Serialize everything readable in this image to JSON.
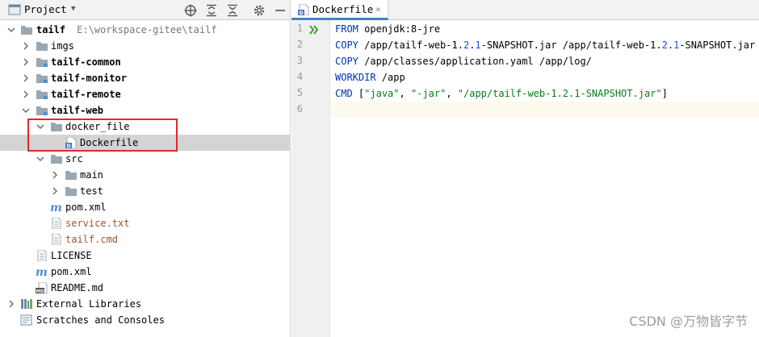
{
  "project_panel": {
    "title": "Project",
    "icons": [
      "project-icon",
      "dropdown-icon",
      "locate-icon",
      "expand-all-icon",
      "collapse-all-icon",
      "gear-icon",
      "minimize-icon"
    ],
    "tree": [
      {
        "label": "tailf",
        "path": "E:\\workspace-gitee\\tailf"
      },
      {
        "label": "imgs"
      },
      {
        "label": "tailf-common"
      },
      {
        "label": "tailf-monitor"
      },
      {
        "label": "tailf-remote"
      },
      {
        "label": "tailf-web"
      },
      {
        "label": "docker_file"
      },
      {
        "label": "Dockerfile"
      },
      {
        "label": "src"
      },
      {
        "label": "main"
      },
      {
        "label": "test"
      },
      {
        "label": "pom.xml"
      },
      {
        "label": "service.txt"
      },
      {
        "label": "tailf.cmd"
      },
      {
        "label": "LICENSE"
      },
      {
        "label": "pom.xml"
      },
      {
        "label": "README.md"
      },
      {
        "label": "External Libraries"
      },
      {
        "label": "Scratches and Consoles"
      }
    ]
  },
  "editor": {
    "tab_label": "Dockerfile",
    "tab_close": "×",
    "line_numbers": [
      "1",
      "2",
      "3",
      "4",
      "5",
      "6"
    ],
    "code": [
      {
        "kw": "FROM",
        "rest": " openjdk:8-jre"
      },
      {
        "kw": "COPY",
        "a": " /app/tailf-web-1.",
        "n1": "2",
        "b": ".",
        "n2": "1",
        "c": "-SNAPSHOT.jar /app/tailf-web-1.",
        "n3": "2",
        "d": ".",
        "n4": "1",
        "e": "-SNAPSHOT.jar"
      },
      {
        "kw": "COPY",
        "rest": " /app/classes/application.yaml /app/log/"
      },
      {
        "kw": "WORKDIR",
        "rest": " /app"
      },
      {
        "kw": "CMD",
        "open": " [",
        "s1": "\"java\"",
        "sep1": ", ",
        "s2": "\"-jar\"",
        "sep2": ", ",
        "s3": "\"/app/tailf-web-1.2.1-SNAPSHOT.jar\"",
        "close": "]"
      }
    ]
  },
  "watermark": "CSDN @万物皆字节",
  "colors": {
    "selection": "#d4d4d4",
    "highlight_box": "#e0282e",
    "keyword": "#0033b3",
    "string": "#067d17",
    "number": "#1750eb",
    "tab_underline": "#4083c9"
  }
}
